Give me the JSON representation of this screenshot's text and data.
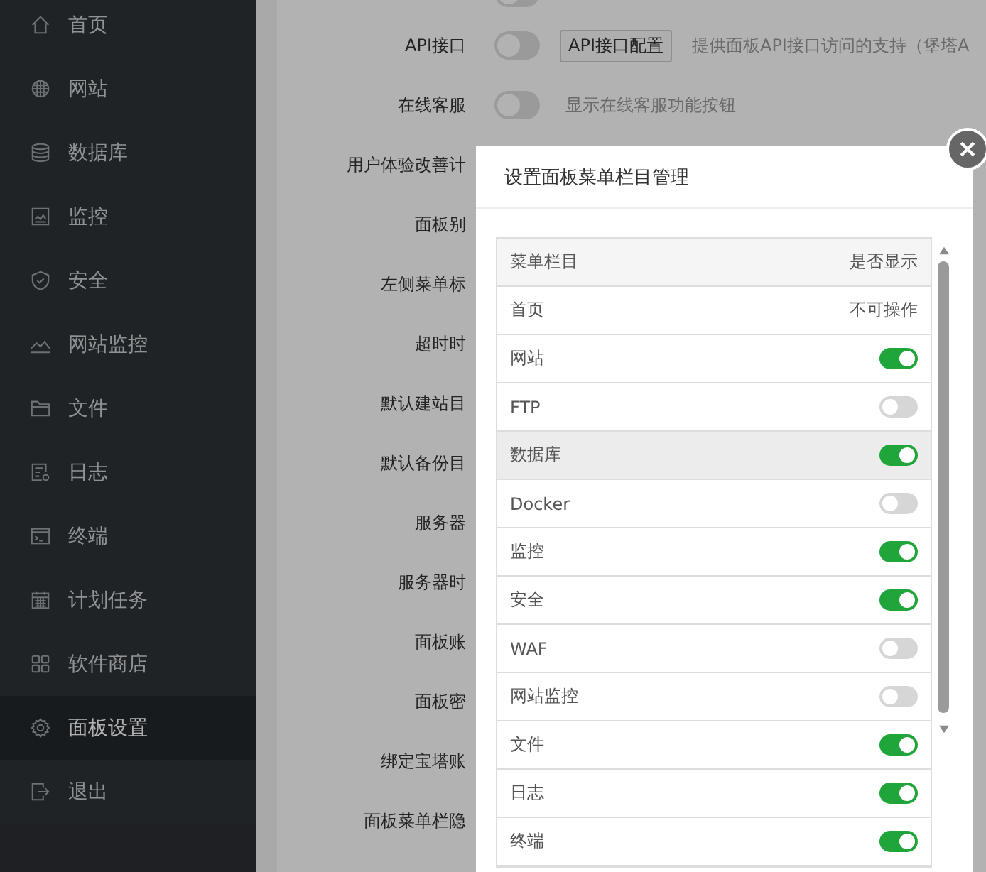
{
  "sidebar": {
    "items": [
      {
        "label": "首页",
        "selected": false
      },
      {
        "label": "网站",
        "selected": false
      },
      {
        "label": "数据库",
        "selected": false
      },
      {
        "label": "监控",
        "selected": false
      },
      {
        "label": "安全",
        "selected": false
      },
      {
        "label": "网站监控",
        "selected": false
      },
      {
        "label": "文件",
        "selected": false
      },
      {
        "label": "日志",
        "selected": false
      },
      {
        "label": "终端",
        "selected": false
      },
      {
        "label": "计划任务",
        "selected": false
      },
      {
        "label": "软件商店",
        "selected": false
      },
      {
        "label": "面板设置",
        "selected": true
      },
      {
        "label": "退出",
        "selected": false
      }
    ]
  },
  "settings": {
    "rows": [
      {
        "toggle": false
      },
      {
        "label": "API接口",
        "toggle": false,
        "button": "API接口配置",
        "description": "提供面板API接口访问的支持（堡塔A"
      },
      {
        "label": "在线客服",
        "toggle": false,
        "description": "显示在线客服功能按钮"
      },
      {
        "label": "用户体验改善计"
      },
      {
        "label": "面板别"
      },
      {
        "label": "左侧菜单标"
      },
      {
        "label": "超时时"
      },
      {
        "label": "默认建站目"
      },
      {
        "label": "默认备份目"
      },
      {
        "label": "服务器"
      },
      {
        "label": "服务器时"
      },
      {
        "label": "面板账"
      },
      {
        "label": "面板密"
      },
      {
        "label": "绑定宝塔账"
      },
      {
        "label": "面板菜单栏隐"
      }
    ]
  },
  "dialog": {
    "title": "设置面板菜单栏目管理",
    "table": {
      "columns": [
        "菜单栏目",
        "是否显示"
      ],
      "rows": [
        {
          "name": "首页",
          "kind": "fixed",
          "status": "不可操作",
          "highlighted": false
        },
        {
          "name": "网站",
          "kind": "toggle",
          "on": true,
          "highlighted": false
        },
        {
          "name": "FTP",
          "kind": "toggle",
          "on": false,
          "highlighted": false
        },
        {
          "name": "数据库",
          "kind": "toggle",
          "on": true,
          "highlighted": true
        },
        {
          "name": "Docker",
          "kind": "toggle",
          "on": false,
          "highlighted": false
        },
        {
          "name": "监控",
          "kind": "toggle",
          "on": true,
          "highlighted": false
        },
        {
          "name": "安全",
          "kind": "toggle",
          "on": true,
          "highlighted": false
        },
        {
          "name": "WAF",
          "kind": "toggle",
          "on": false,
          "highlighted": false
        },
        {
          "name": "网站监控",
          "kind": "toggle",
          "on": false,
          "highlighted": false
        },
        {
          "name": "文件",
          "kind": "toggle",
          "on": true,
          "highlighted": false
        },
        {
          "name": "日志",
          "kind": "toggle",
          "on": true,
          "highlighted": false
        },
        {
          "name": "终端",
          "kind": "toggle",
          "on": true,
          "highlighted": false
        }
      ]
    }
  }
}
